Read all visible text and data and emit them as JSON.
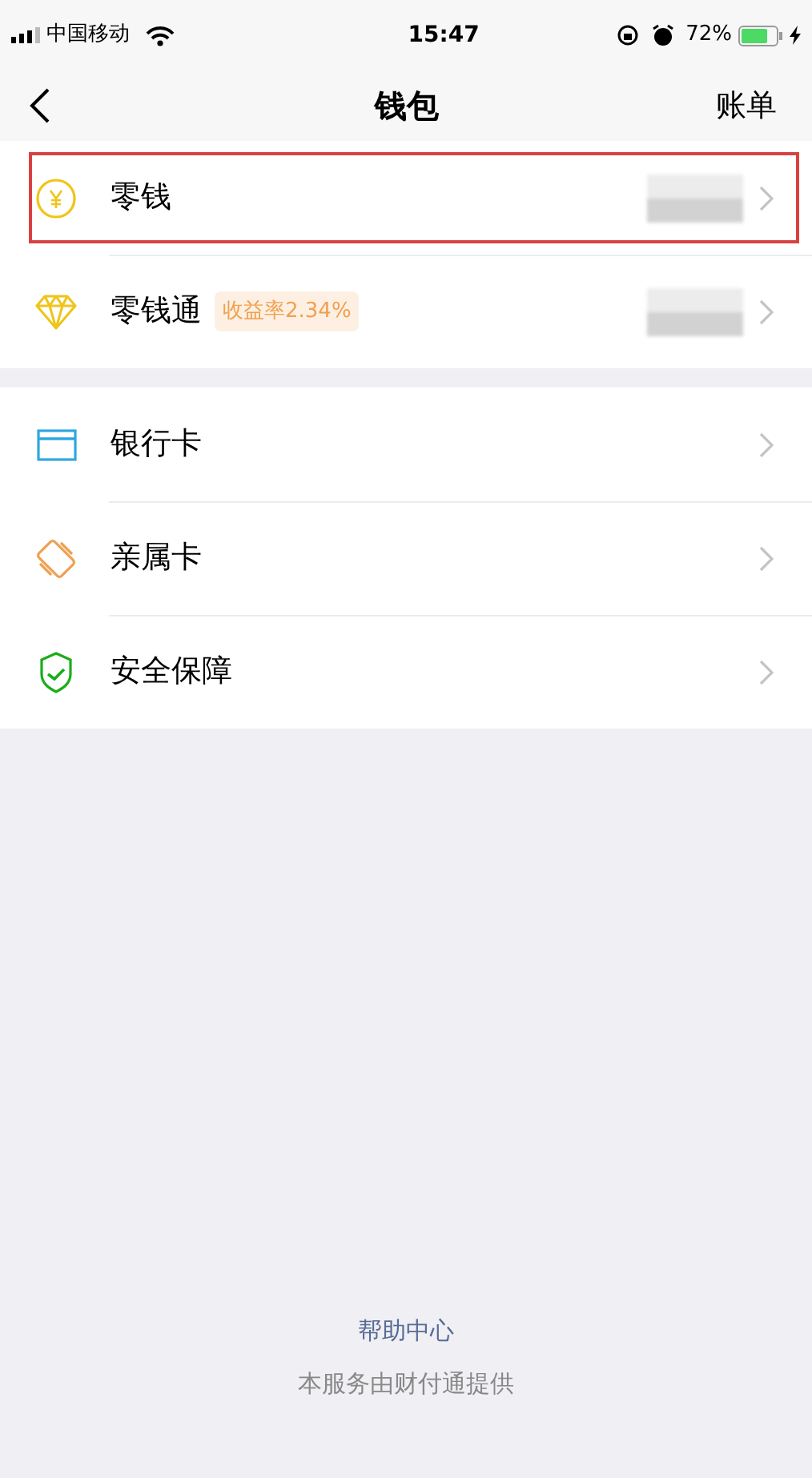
{
  "status_bar": {
    "carrier": "中国移动",
    "time": "15:47",
    "battery": "72%"
  },
  "nav": {
    "title": "钱包",
    "action": "账单"
  },
  "sections": [
    {
      "items": [
        {
          "kind": "coin",
          "label": "零钱",
          "masked": true,
          "highlighted": true
        },
        {
          "kind": "diamond",
          "label": "零钱通",
          "badge": "收益率2.34%",
          "masked": true,
          "highlighted": false
        }
      ]
    },
    {
      "items": [
        {
          "kind": "card",
          "label": "银行卡",
          "masked": false,
          "highlighted": false
        },
        {
          "kind": "family",
          "label": "亲属卡",
          "masked": false,
          "highlighted": false
        },
        {
          "kind": "shield",
          "label": "安全保障",
          "masked": false,
          "highlighted": false
        }
      ]
    }
  ],
  "footer": {
    "link": "帮助中心",
    "note": "本服务由财付通提供"
  }
}
